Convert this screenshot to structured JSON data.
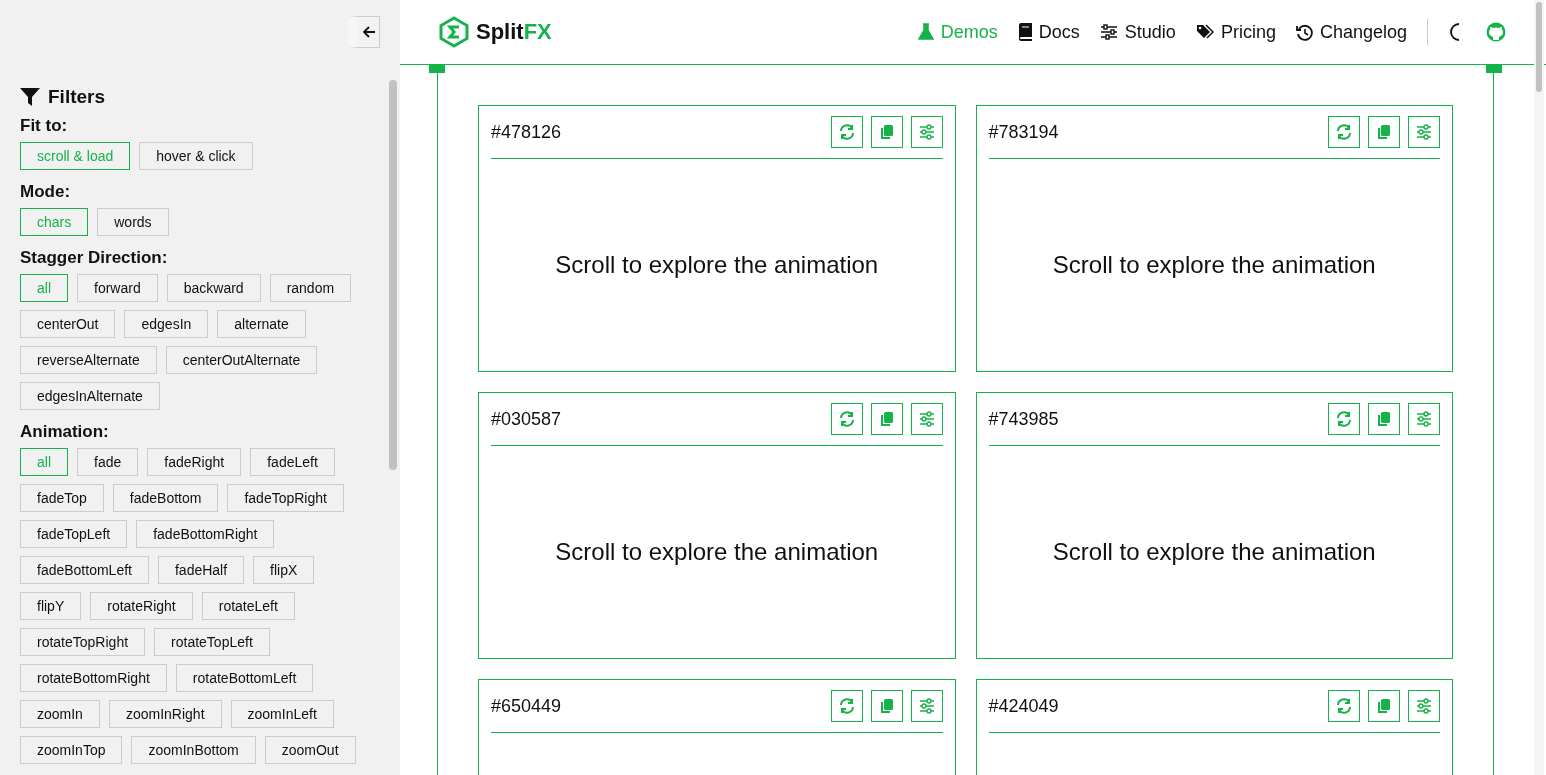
{
  "sidebar": {
    "title": "Filters",
    "groups": [
      {
        "label": "Fit to:",
        "options": [
          {
            "label": "scroll & load",
            "selected": true
          },
          {
            "label": "hover & click",
            "selected": false
          }
        ]
      },
      {
        "label": "Mode:",
        "options": [
          {
            "label": "chars",
            "selected": true
          },
          {
            "label": "words",
            "selected": false
          }
        ]
      },
      {
        "label": "Stagger Direction:",
        "options": [
          {
            "label": "all",
            "selected": true
          },
          {
            "label": "forward",
            "selected": false
          },
          {
            "label": "backward",
            "selected": false
          },
          {
            "label": "random",
            "selected": false
          },
          {
            "label": "centerOut",
            "selected": false
          },
          {
            "label": "edgesIn",
            "selected": false
          },
          {
            "label": "alternate",
            "selected": false
          },
          {
            "label": "reverseAlternate",
            "selected": false
          },
          {
            "label": "centerOutAlternate",
            "selected": false
          },
          {
            "label": "edgesInAlternate",
            "selected": false
          }
        ]
      },
      {
        "label": "Animation:",
        "options": [
          {
            "label": "all",
            "selected": true
          },
          {
            "label": "fade",
            "selected": false
          },
          {
            "label": "fadeRight",
            "selected": false
          },
          {
            "label": "fadeLeft",
            "selected": false
          },
          {
            "label": "fadeTop",
            "selected": false
          },
          {
            "label": "fadeBottom",
            "selected": false
          },
          {
            "label": "fadeTopRight",
            "selected": false
          },
          {
            "label": "fadeTopLeft",
            "selected": false
          },
          {
            "label": "fadeBottomRight",
            "selected": false
          },
          {
            "label": "fadeBottomLeft",
            "selected": false
          },
          {
            "label": "fadeHalf",
            "selected": false
          },
          {
            "label": "flipX",
            "selected": false
          },
          {
            "label": "flipY",
            "selected": false
          },
          {
            "label": "rotateRight",
            "selected": false
          },
          {
            "label": "rotateLeft",
            "selected": false
          },
          {
            "label": "rotateTopRight",
            "selected": false
          },
          {
            "label": "rotateTopLeft",
            "selected": false
          },
          {
            "label": "rotateBottomRight",
            "selected": false
          },
          {
            "label": "rotateBottomLeft",
            "selected": false
          },
          {
            "label": "zoomIn",
            "selected": false
          },
          {
            "label": "zoomInRight",
            "selected": false
          },
          {
            "label": "zoomInLeft",
            "selected": false
          },
          {
            "label": "zoomInTop",
            "selected": false
          },
          {
            "label": "zoomInBottom",
            "selected": false
          },
          {
            "label": "zoomOut",
            "selected": false
          }
        ]
      }
    ]
  },
  "brand": {
    "name": "Split",
    "accent": "FX"
  },
  "nav": [
    {
      "label": "Demos",
      "kind": "flask",
      "selected": true
    },
    {
      "label": "Docs",
      "kind": "book",
      "selected": false
    },
    {
      "label": "Studio",
      "kind": "sliders",
      "selected": false
    },
    {
      "label": "Pricing",
      "kind": "tags",
      "selected": false
    },
    {
      "label": "Changelog",
      "kind": "history",
      "selected": false
    }
  ],
  "cards": [
    {
      "id": "#478126",
      "message": "Scroll to explore the animation"
    },
    {
      "id": "#783194",
      "message": "Scroll to explore the animation"
    },
    {
      "id": "#030587",
      "message": "Scroll to explore the animation"
    },
    {
      "id": "#743985",
      "message": "Scroll to explore the animation"
    },
    {
      "id": "#650449"
    },
    {
      "id": "#424049"
    }
  ]
}
